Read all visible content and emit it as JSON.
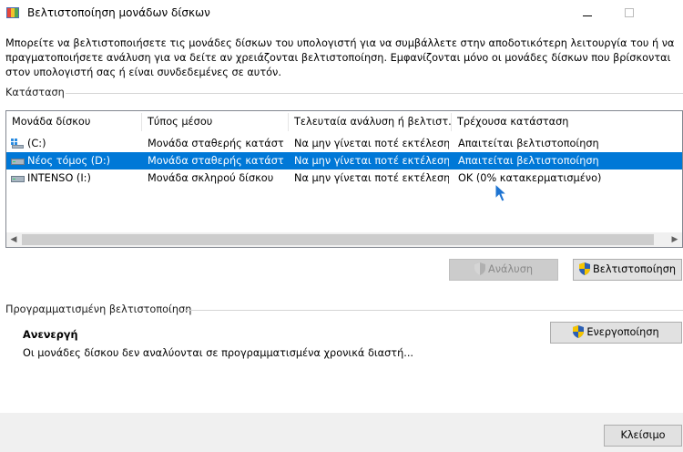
{
  "window": {
    "title": "Βελτιστοποίηση μονάδων δίσκων",
    "app_icon": "defrag-icon"
  },
  "description": "Μπορείτε να βελτιστοποιήσετε τις μονάδες δίσκων του υπολογιστή για να συμβάλλετε στην αποδοτικότερη λειτουργία του ή να πραγματοποιήσετε ανάλυση για να δείτε αν χρειάζονται βελτιστοποίηση. Εμφανίζονται μόνο οι μονάδες δίσκων που βρίσκονται στον υπολογιστή σας ή είναι συνδεδεμένες σε αυτόν.",
  "status_section": {
    "label": "Κατάσταση",
    "columns": [
      "Μονάδα δίσκου",
      "Τύπος μέσου",
      "Τελευταία ανάλυση ή βελτιστ...",
      "Τρέχουσα κατάσταση"
    ],
    "rows": [
      {
        "drive": "(C:)",
        "media": "Μονάδα σταθερής κατάστ...",
        "last": "Να μην γίνεται ποτέ εκτέλεση",
        "status": "Απαιτείται βελτιστοποίηση",
        "icon": "windows-drive-icon",
        "selected": false
      },
      {
        "drive": "Νέος τόμος (D:)",
        "media": "Μονάδα σταθερής κατάστ...",
        "last": "Να μην γίνεται ποτέ εκτέλεση",
        "status": "Απαιτείται βελτιστοποίηση",
        "icon": "drive-icon",
        "selected": true
      },
      {
        "drive": "INTENSO (I:)",
        "media": "Μονάδα σκληρού δίσκου",
        "last": "Να μην γίνεται ποτέ εκτέλεση",
        "status": "OK (0% κατακερματισμένο)",
        "icon": "drive-icon",
        "selected": false
      }
    ],
    "analyze_button": "Ανάλυση",
    "optimize_button": "Βελτιστοποίηση"
  },
  "schedule_section": {
    "label": "Προγραμματισμένη βελτιστοποίηση",
    "state": "Ανενεργή",
    "state_desc": "Οι μονάδες δίσκου δεν αναλύονται σε προγραμματισμένα χρονικά διαστή...",
    "enable_button": "Ενεργοποίηση"
  },
  "close_button": "Κλείσιμο",
  "colors": {
    "selection": "#0078d7",
    "shield_blue": "#2b5fb4",
    "shield_yellow": "#f5c400"
  }
}
